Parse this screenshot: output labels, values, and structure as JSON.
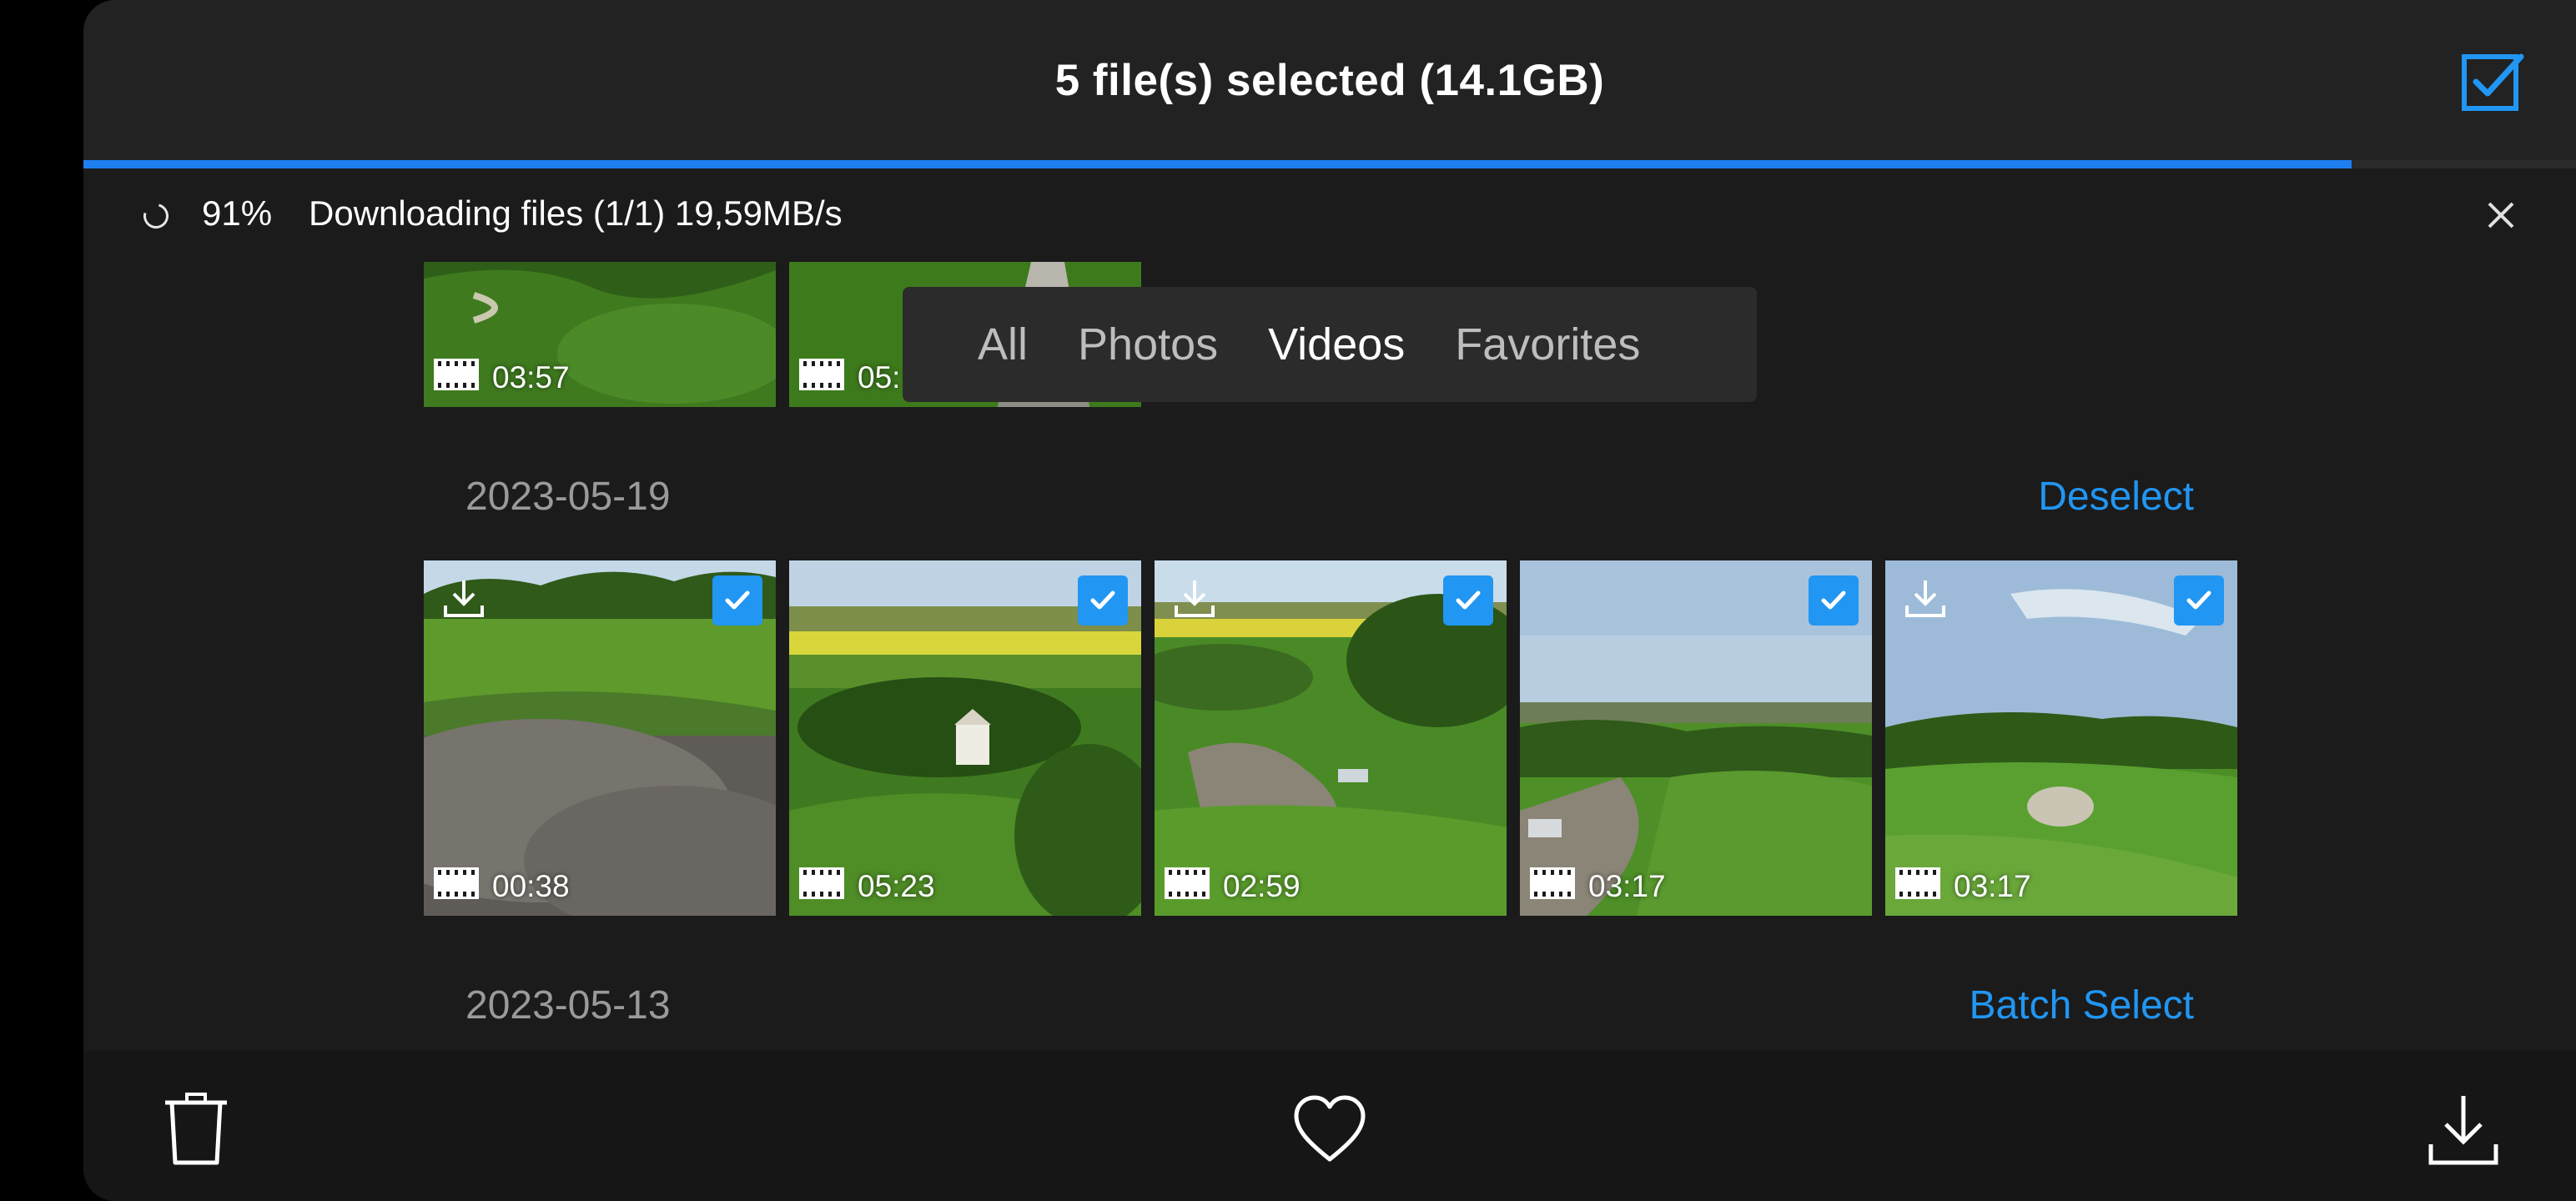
{
  "header": {
    "title": "5 file(s) selected (14.1GB)"
  },
  "download": {
    "percent_label": "91%",
    "progress": 0.91,
    "status": "Downloading files (1/1) 19,59MB/s"
  },
  "filter_tabs": [
    {
      "label": "All",
      "active": false
    },
    {
      "label": "Photos",
      "active": false
    },
    {
      "label": "Videos",
      "active": true
    },
    {
      "label": "Favorites",
      "active": false
    }
  ],
  "top_partial_items": [
    {
      "duration": "03:57"
    },
    {
      "duration": "05:"
    }
  ],
  "groups": [
    {
      "date": "2023-05-19",
      "action": "Deselect",
      "items": [
        {
          "duration": "00:38",
          "selected": true
        },
        {
          "duration": "05:23",
          "selected": true
        },
        {
          "duration": "02:59",
          "selected": true
        },
        {
          "duration": "03:17",
          "selected": true
        },
        {
          "duration": "03:17",
          "selected": true
        }
      ]
    },
    {
      "date": "2023-05-13",
      "action": "Batch Select"
    }
  ],
  "colors": {
    "accent": "#2196f3",
    "progress": "#1e7ff0",
    "background": "#1b1b1b"
  },
  "icons": {
    "header": "select-all-icon",
    "close": "close-icon",
    "bottom": [
      "trash-icon",
      "heart-icon",
      "download-icon"
    ]
  }
}
